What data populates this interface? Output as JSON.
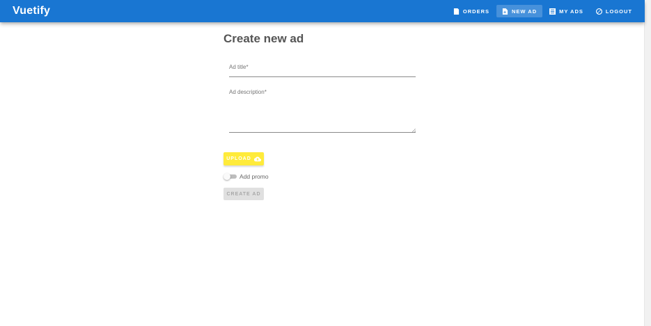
{
  "app": {
    "brand": "Vuetify"
  },
  "nav": {
    "items": [
      {
        "label": "ORDERS",
        "icon": "bookmark-icon"
      },
      {
        "label": "NEW AD",
        "icon": "note-add-icon"
      },
      {
        "label": "MY ADS",
        "icon": "list-icon"
      },
      {
        "label": "LOGOUT",
        "icon": "block-icon"
      }
    ],
    "active": "NEW AD"
  },
  "form": {
    "title": "Create new ad",
    "ad_title": {
      "label": "Ad title*",
      "value": ""
    },
    "ad_description": {
      "label": "Ad description*",
      "value": ""
    },
    "upload_label": "UPLOAD",
    "upload_icon": "cloud-upload-icon",
    "promo_label": "Add promo",
    "promo_enabled": false,
    "create_label": "CREATE AD",
    "create_disabled": true
  },
  "colors": {
    "primary": "#1976d2",
    "upload": "#ffeb3b",
    "disabled": "#e0e0e0"
  }
}
